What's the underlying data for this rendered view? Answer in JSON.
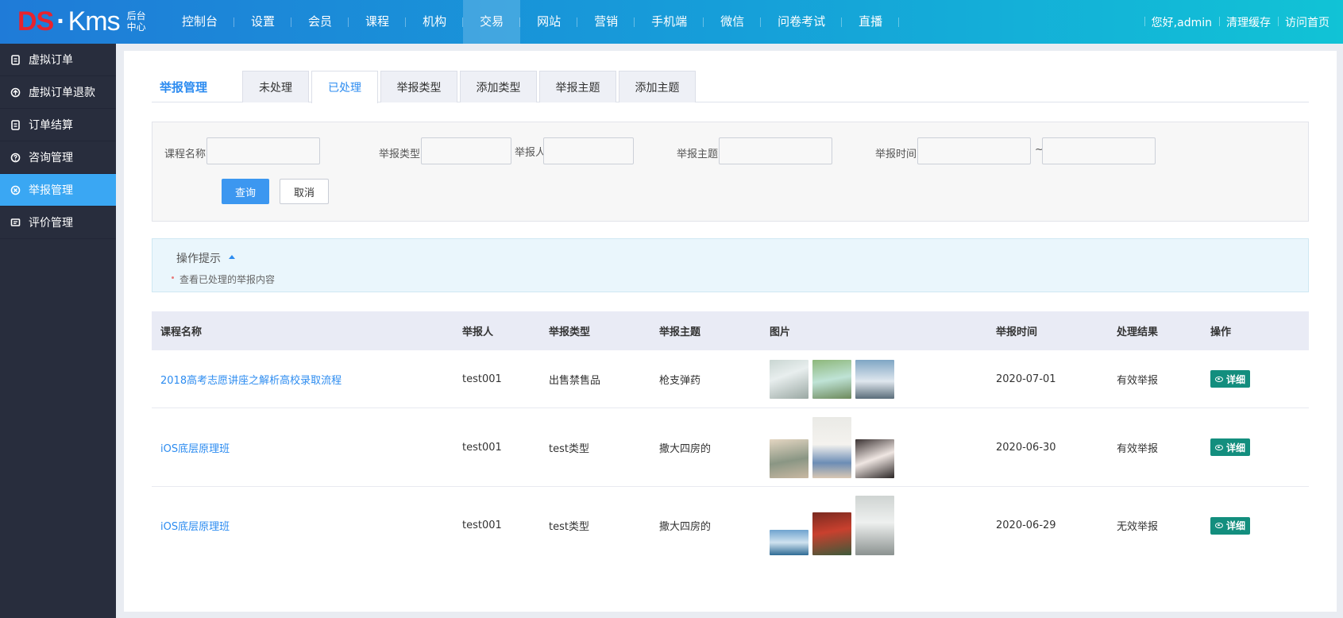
{
  "header": {
    "logo_left": "DS",
    "logo_dot": "·",
    "logo_right": "Kms",
    "logo_sub_line1": "后台",
    "logo_sub_line2": "中心",
    "nav": [
      "控制台",
      "设置",
      "会员",
      "课程",
      "机构",
      "交易",
      "网站",
      "营销",
      "手机端",
      "微信",
      "问卷考试",
      "直播"
    ],
    "nav_active": "交易",
    "greeting": "您好,admin",
    "clear_cache": "清理缓存",
    "visit_home": "访问首页"
  },
  "sidebar": {
    "items": [
      {
        "label": "虚拟订单",
        "icon": "doc-icon"
      },
      {
        "label": "虚拟订单退款",
        "icon": "refund-icon"
      },
      {
        "label": "订单结算",
        "icon": "doc-icon"
      },
      {
        "label": "咨询管理",
        "icon": "question-icon"
      },
      {
        "label": "举报管理",
        "icon": "report-icon"
      },
      {
        "label": "评价管理",
        "icon": "comment-icon"
      }
    ],
    "active": "举报管理"
  },
  "tabs": {
    "title": "举报管理",
    "items": [
      "未处理",
      "已处理",
      "举报类型",
      "添加类型",
      "举报主题",
      "添加主题"
    ],
    "active": "已处理"
  },
  "search": {
    "course_label": "课程名称",
    "type_label": "举报类型",
    "reporter_label": "举报人",
    "subject_label": "举报主题",
    "time_label": "举报时间",
    "tilde": "~",
    "query_button": "查询",
    "cancel_button": "取消"
  },
  "tips": {
    "title": "操作提示",
    "text": "查看已处理的举报内容"
  },
  "table": {
    "headers": [
      "课程名称",
      "举报人",
      "举报类型",
      "举报主题",
      "图片",
      "举报时间",
      "处理结果",
      "操作"
    ],
    "rows": [
      {
        "course": "2018高考志愿讲座之解析高校录取流程",
        "reporter": "test001",
        "type": "出售禁售品",
        "subject": "枪支弹药",
        "time": "2020-07-01",
        "result": "有效举报",
        "action": "详细"
      },
      {
        "course": "iOS底层原理班",
        "reporter": "test001",
        "type": "test类型",
        "subject": "撒大四房的",
        "time": "2020-06-30",
        "result": "有效举报",
        "action": "详细"
      },
      {
        "course": "iOS底层原理班",
        "reporter": "test001",
        "type": "test类型",
        "subject": "撒大四房的",
        "time": "2020-06-29",
        "result": "无效举报",
        "action": "详细"
      }
    ]
  },
  "colors": {
    "accent": "#2d8cf0",
    "sidebar_bg": "#282d3d",
    "sidebar_active": "#3aa7f3",
    "detail_button": "#138e7e"
  }
}
